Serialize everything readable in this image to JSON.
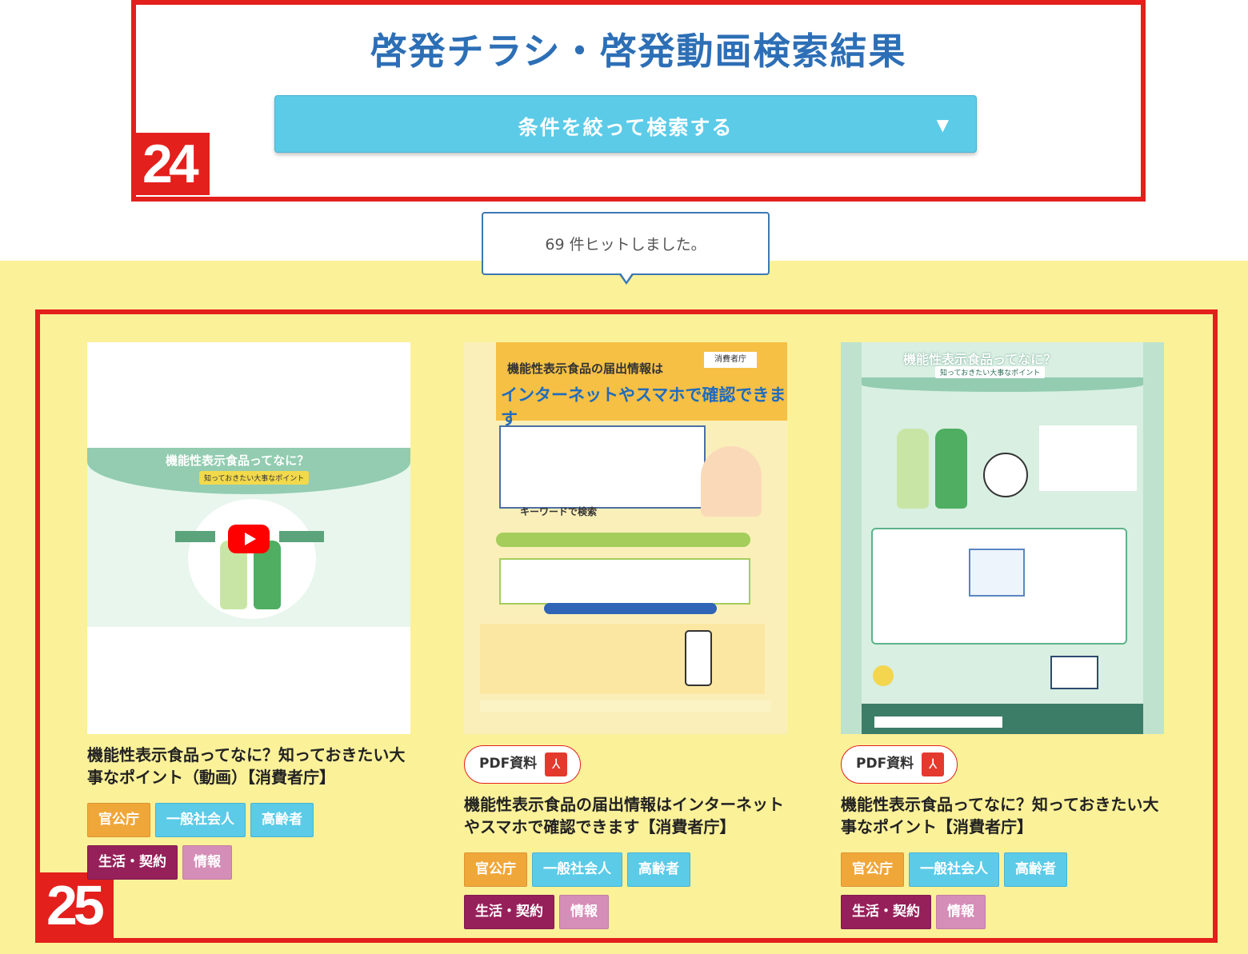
{
  "header": {
    "title": "啓発チラシ・啓発動画検索結果",
    "filter_button": "条件を絞って検索する",
    "filter_caret": "▼",
    "section_number": "24"
  },
  "results": {
    "hit_count_text": "69 件ヒットしました。",
    "section_number": "25",
    "cards": [
      {
        "title": "機能性表示食品ってなに？知っておきたい大事なポイント（動画）【消費者庁】",
        "tags": [
          "官公庁",
          "一般社会人",
          "高齢者",
          "生活・契約",
          "情報"
        ],
        "thumbnail": {
          "title": "機能性表示食品ってなに？",
          "subtitle": "知っておきたい大事なポイント"
        }
      },
      {
        "badge": "PDF資料",
        "title": "機能性表示食品の届出情報はインターネットやスマホで確認できます【消費者庁】",
        "tags": [
          "官公庁",
          "一般社会人",
          "高齢者",
          "生活・契約",
          "情報"
        ],
        "thumbnail": {
          "line1": "機能性表示食品の届出情報は",
          "line2": "インターネットやスマホで確認できます",
          "keyword": "キーワードで検索",
          "logo": "消費者庁"
        }
      },
      {
        "badge": "PDF資料",
        "title": "機能性表示食品ってなに？知っておきたい大事なポイント【消費者庁】",
        "tags": [
          "官公庁",
          "一般社会人",
          "高齢者",
          "生活・契約",
          "情報"
        ],
        "thumbnail": {
          "title": "機能性表示食品ってなに？",
          "subtitle": "知っておきたい大事なポイント"
        }
      }
    ]
  },
  "colors": {
    "accent_red": "#e3201c",
    "title_blue": "#2d6fb6",
    "button_cyan": "#5bcbe8",
    "band_yellow": "#fbf199",
    "tag_orange": "#f0a73a",
    "tag_maroon": "#96205a",
    "tag_pink": "#d58eb7"
  },
  "icons": [
    "caret-down-icon",
    "pdf-icon",
    "youtube-play-icon"
  ]
}
